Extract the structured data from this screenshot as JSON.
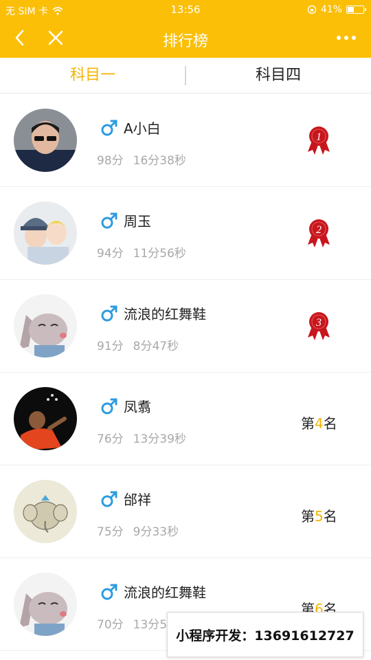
{
  "status_bar": {
    "carrier": "无 SIM 卡",
    "time": "13:56",
    "battery": "41%",
    "battery_level": 0.41
  },
  "nav": {
    "title": "排行榜"
  },
  "tabs": [
    {
      "label": "科目一",
      "active": true
    },
    {
      "label": "科目四",
      "active": false
    }
  ],
  "colors": {
    "brand": "#fbbf08",
    "accent": "#f4b400",
    "medal_red": "#c8161d",
    "male_blue": "#2c9be0"
  },
  "rankings": [
    {
      "name": "A小白",
      "score": "98分",
      "time": "16分38秒",
      "medal": "1"
    },
    {
      "name": "周玉",
      "score": "94分",
      "time": "11分56秒",
      "medal": "2"
    },
    {
      "name": "流浪的红舞鞋",
      "score": "91分",
      "time": "8分47秒",
      "medal": "3"
    },
    {
      "name": "凤翥",
      "score": "76分",
      "time": "13分39秒",
      "rank_prefix": "第",
      "rank": "4",
      "rank_suffix": "名"
    },
    {
      "name": "邰祥",
      "score": "75分",
      "time": "9分33秒",
      "rank_prefix": "第",
      "rank": "5",
      "rank_suffix": "名"
    },
    {
      "name": "流浪的红舞鞋",
      "score": "70分",
      "time": "13分5",
      "rank_prefix": "第",
      "rank": "6",
      "rank_suffix": "名"
    }
  ],
  "promo": {
    "text": "小程序开发：13691612727"
  }
}
